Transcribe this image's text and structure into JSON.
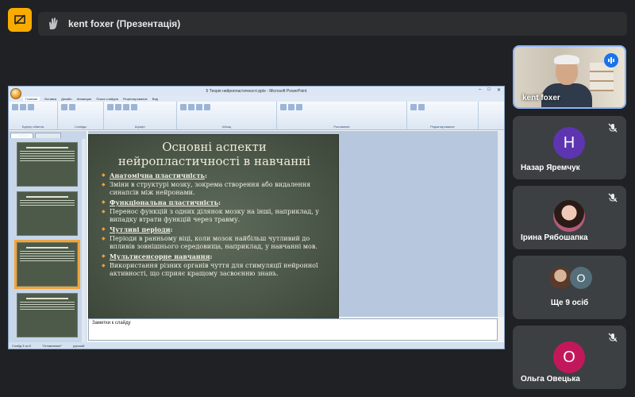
{
  "presenter": {
    "title": "kent foxer (Презентація)"
  },
  "ppt": {
    "window_title": "5 Теорія нейропластичності.pptx - Microsoft PowerPoint",
    "ribbon_tabs": [
      "Главная",
      "Вставка",
      "Дизайн",
      "Анимация",
      "Показ слайдов",
      "Рецензирование",
      "Вид"
    ],
    "ribbon_groups": [
      "Буфер обмена",
      "Слайды",
      "Шрифт",
      "Абзац",
      "Рисование",
      "Редактирование"
    ],
    "pane_tabs": [
      "Слайды",
      "Структура"
    ],
    "notes_placeholder": "Заметки к слайду",
    "status_left": "Слайд 3 из 5",
    "status_theme": "\"Оглавление\"",
    "status_lang": "русский"
  },
  "slide": {
    "title": "Основні аспекти нейропластичності в навчанні",
    "bullets": [
      {
        "head": true,
        "text": "Анатомічна пластичність",
        "suffix": ":"
      },
      {
        "head": false,
        "text": "Зміни в структурі мозку, зокрема створення або видалення синапсів між нейронами."
      },
      {
        "head": true,
        "text": "Функціональна пластичність",
        "suffix": ":"
      },
      {
        "head": false,
        "text": "Перенос функцій з одних ділянок мозку на інші, наприклад, у випадку втрати функцій через травму."
      },
      {
        "head": true,
        "text": "Чутливі періоди",
        "suffix": ":"
      },
      {
        "head": false,
        "text": "Періоди в ранньому віці, коли мозок найбільш чутливий до впливів зовнішнього середовища, наприклад, у навчанні мов."
      },
      {
        "head": true,
        "text": "Мультисенсорне навчання",
        "suffix": ":"
      },
      {
        "head": false,
        "text": "Використання різних органів чуття для стимуляції нейронної активності, що сприяє кращому засвоєнню знань."
      }
    ]
  },
  "participants": {
    "speaker": "kent foxer",
    "p1_name": "Назар Яремчук",
    "p1_initial": "Н",
    "p1_color": "#5e35b1",
    "p2_name": "Ірина Рябошапка",
    "more_label": "Ще 9 осіб",
    "more_initial": "O",
    "p3_name": "Ольга Овецька",
    "p3_initial": "O",
    "p3_color": "#c2185b"
  },
  "icons": {
    "present": "present-stop-icon",
    "mic_muted": "mic-off-icon",
    "speaking": "speaking-icon"
  }
}
